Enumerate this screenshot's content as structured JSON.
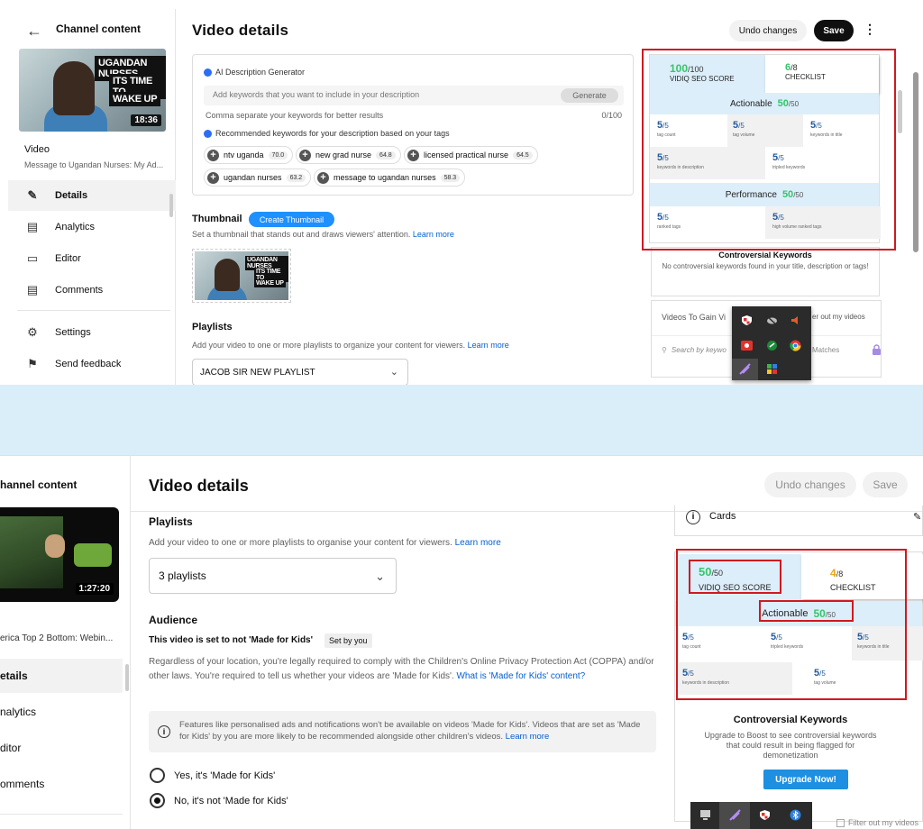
{
  "top": {
    "sidebar": {
      "back_label": "Channel content",
      "duration": "18:36",
      "thumb_banner": [
        "UGANDAN NURSES",
        "ITS TIME TO",
        "WAKE UP"
      ],
      "video_label": "Video",
      "video_title": "Message to Ugandan Nurses: My Ad...",
      "nav": [
        {
          "label": "Details",
          "icon": "pencil-icon"
        },
        {
          "label": "Analytics",
          "icon": "bar-chart-icon"
        },
        {
          "label": "Editor",
          "icon": "film-icon"
        },
        {
          "label": "Comments",
          "icon": "comment-icon"
        },
        {
          "label": "Settings",
          "icon": "gear-icon"
        },
        {
          "label": "Send feedback",
          "icon": "feedback-icon"
        }
      ]
    },
    "header": {
      "title": "Video details",
      "undo": "Undo changes",
      "save": "Save"
    },
    "ai": {
      "heading": "AI Description Generator",
      "placeholder": "Add keywords that you want to include in your description",
      "generate": "Generate",
      "hint": "Comma separate your keywords for better results",
      "count": "0/100",
      "recommended": "Recommended keywords for your description based on your tags",
      "tags": [
        {
          "label": "ntv uganda",
          "score": "70.0"
        },
        {
          "label": "new grad nurse",
          "score": "64.8"
        },
        {
          "label": "licensed practical nurse",
          "score": "64.5"
        },
        {
          "label": "ugandan nurses",
          "score": "63.2"
        },
        {
          "label": "message to ugandan nurses",
          "score": "58.3"
        }
      ]
    },
    "thumbnail": {
      "label": "Thumbnail",
      "create": "Create Thumbnail",
      "desc": "Set a thumbnail that stands out and draws viewers' attention.",
      "learn": "Learn more"
    },
    "playlists": {
      "label": "Playlists",
      "desc": "Add your video to one or more playlists to organize your content for viewers.",
      "learn": "Learn more",
      "selected": "JACOB SIR NEW PLAYLIST"
    },
    "score": {
      "seo_num": "100",
      "seo_den": "/100",
      "seo_label": "VIDIQ SEO SCORE",
      "check_num": "6",
      "check_den": "/8",
      "check_label": "CHECKLIST",
      "actionable_label": "Actionable",
      "actionable_num": "50",
      "actionable_den": "/50",
      "actionable_metrics": [
        {
          "v": "5",
          "d": "/5",
          "l": "tag count"
        },
        {
          "v": "5",
          "d": "/5",
          "l": "tag volume"
        },
        {
          "v": "5",
          "d": "/5",
          "l": "keywords in title"
        },
        {
          "v": "5",
          "d": "/5",
          "l": "keywords in description"
        },
        {
          "v": "5",
          "d": "/5",
          "l": "tripled keywords"
        }
      ],
      "performance_label": "Performance",
      "performance_num": "50",
      "performance_den": "/50",
      "performance_metrics": [
        {
          "v": "5",
          "d": "/5",
          "l": "ranked tags"
        },
        {
          "v": "5",
          "d": "/5",
          "l": "high volume ranked tags"
        }
      ]
    },
    "controversial": {
      "heading": "Controversial Keywords",
      "desc": "No controversial keywords found in your title, description or tags!"
    },
    "gain": {
      "title": "Videos To Gain Vi",
      "filter": "er out my videos",
      "search": "Search by keywo",
      "matches": "Matches"
    }
  },
  "bottom": {
    "sidebar": {
      "channel": "hannel content",
      "duration": "1:27:20",
      "video_title": "erica Top 2 Bottom: Webin...",
      "nav": [
        "etails",
        "nalytics",
        "ditor",
        "omments"
      ]
    },
    "header": {
      "title": "Video details",
      "undo": "Undo changes",
      "save": "Save"
    },
    "playlists": {
      "label": "Playlists",
      "desc": "Add your video to one or more playlists to organise your content for viewers.",
      "learn": "Learn more",
      "selected": "3 playlists"
    },
    "audience": {
      "label": "Audience",
      "set_text": "This video is set to not 'Made for Kids'",
      "set_by": "Set by you",
      "text": "Regardless of your location, you're legally required to comply with the Children's Online Privacy Protection Act (COPPA) and/or other laws. You're required to tell us whether your videos are 'Made for Kids'.",
      "what_link": "What is 'Made for Kids' content?",
      "info": "Features like personalised ads and notifications won't be available on videos 'Made for Kids'. Videos that are set as 'Made for Kids' by you are more likely to be recommended alongside other children's videos.",
      "info_link": "Learn more",
      "option_yes": "Yes, it's 'Made for Kids'",
      "option_no": "No, it's not 'Made for Kids'"
    },
    "cards_label": "Cards",
    "score": {
      "seo_num": "50",
      "seo_den": "/50",
      "seo_label": "VIDIQ SEO SCORE",
      "check_num": "4",
      "check_den": "/8",
      "check_label": "CHECKLIST",
      "actionable_label": "Actionable",
      "actionable_num": "50",
      "actionable_den": "/50",
      "metrics": [
        {
          "v": "5",
          "d": "/5",
          "l": "tag count"
        },
        {
          "v": "5",
          "d": "/5",
          "l": "tripled keywords"
        },
        {
          "v": "5",
          "d": "/5",
          "l": "keywords in title"
        },
        {
          "v": "5",
          "d": "/5",
          "l": "keywords in description"
        },
        {
          "v": "5",
          "d": "/5",
          "l": "tag volume"
        }
      ]
    },
    "controversial": {
      "heading": "Controversial Keywords",
      "desc": "Upgrade to Boost to see controversial keywords that could result in being flagged for demonetization",
      "upgrade": "Upgrade Now!"
    },
    "filter": "Filter out my videos"
  },
  "colors": {
    "green": "#35c56a",
    "blue_link": "#065fd4",
    "red_highlight": "#d0191f",
    "score_bg": "#ddeefb",
    "gap_bg": "#daeefa"
  }
}
